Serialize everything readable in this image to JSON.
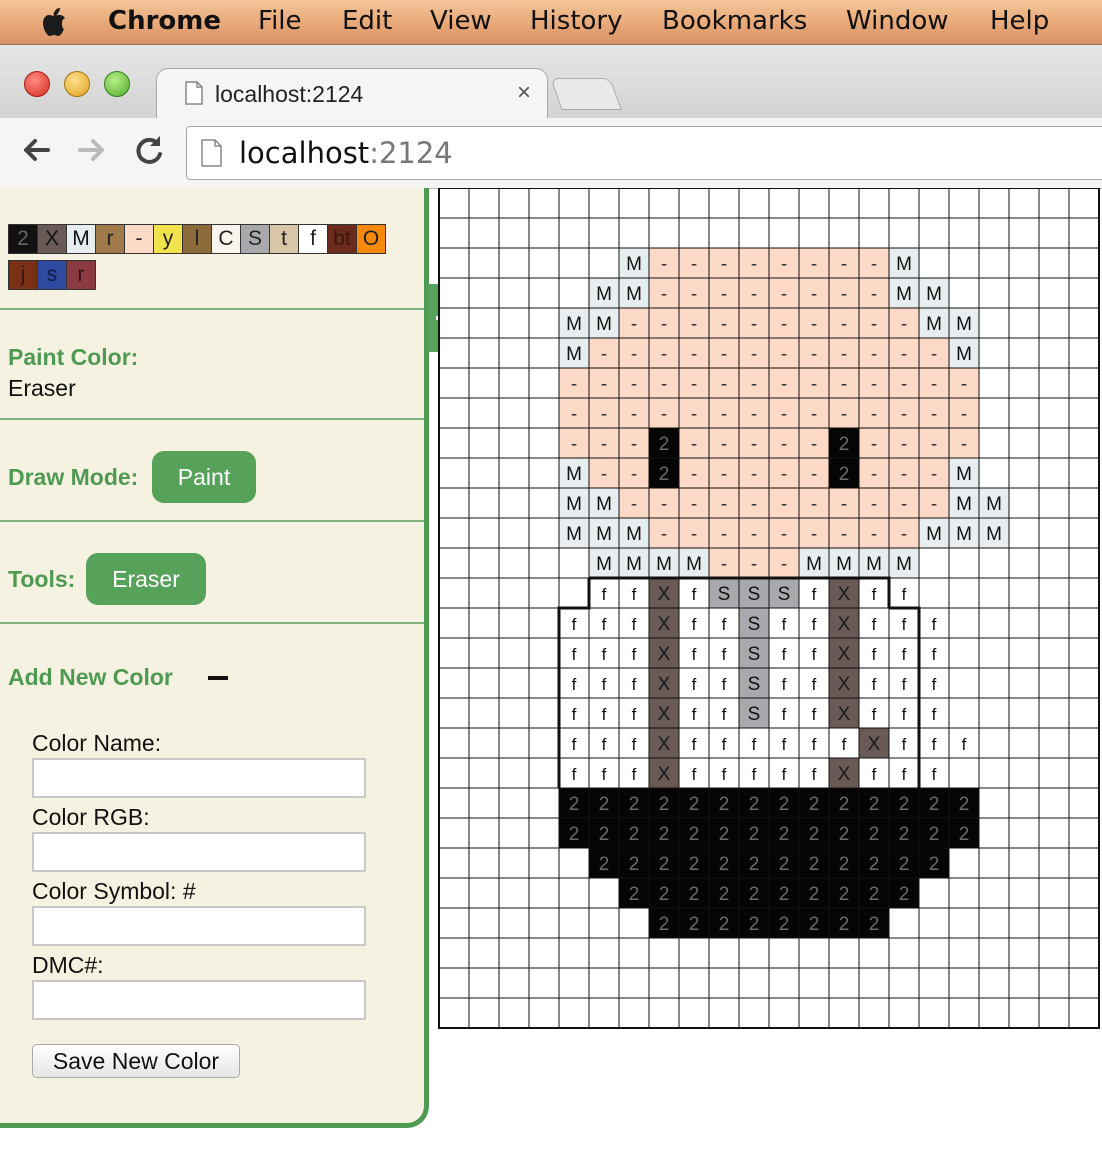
{
  "menubar": {
    "app_name": "Chrome",
    "items": [
      "File",
      "Edit",
      "View",
      "History",
      "Bookmarks",
      "Window",
      "Help"
    ]
  },
  "browser": {
    "tab_title": "localhost:2124",
    "tab_close": "×",
    "url_host": "localhost",
    "url_port": ":2124"
  },
  "palette": [
    {
      "symbol": "2",
      "color": "#111111",
      "text": "#666666"
    },
    {
      "symbol": "X",
      "color": "#6a5a57",
      "text": "#111111"
    },
    {
      "symbol": "M",
      "color": "#e8eef0",
      "text": "#111111"
    },
    {
      "symbol": "r",
      "color": "#a07a4b",
      "text": "#222222"
    },
    {
      "symbol": "-",
      "color": "#fdd9c7",
      "text": "#222222"
    },
    {
      "symbol": "y",
      "color": "#f2e24b",
      "text": "#222222"
    },
    {
      "symbol": "l",
      "color": "#8b6b3a",
      "text": "#222222"
    },
    {
      "symbol": "C",
      "color": "#f7f5ee",
      "text": "#222222"
    },
    {
      "symbol": "S",
      "color": "#a9a9ad",
      "text": "#222222"
    },
    {
      "symbol": "t",
      "color": "#d8c7a6",
      "text": "#222222"
    },
    {
      "symbol": "f",
      "color": "#ffffff",
      "text": "#222222"
    },
    {
      "symbol": "bt",
      "color": "#6a2a1c",
      "text": "#3a1510"
    },
    {
      "symbol": "O",
      "color": "#f78a0c",
      "text": "#222222"
    },
    {
      "symbol": "j",
      "color": "#7a3015",
      "text": "#3a1510"
    },
    {
      "symbol": "s",
      "color": "#2d4aa0",
      "text": "#111a44"
    },
    {
      "symbol": "r",
      "color": "#8a3a40",
      "text": "#3a1018"
    }
  ],
  "panel": {
    "paint_color_label": "Paint Color:",
    "paint_color_value": "Eraser",
    "draw_mode_label": "Draw Mode:",
    "draw_mode_button": "Paint",
    "tools_label": "Tools:",
    "tools_button": "Eraser",
    "add_color_label": "Add New Color",
    "add_color_toggle": "−",
    "color_name_label": "Color Name:",
    "color_rgb_label": "Color RGB:",
    "color_symbol_label": "Color Symbol: #",
    "dmc_label": "DMC#:",
    "save_button": "Save New Color",
    "inputs": {
      "color_name": "",
      "color_rgb": "",
      "color_symbol": "",
      "dmc": ""
    }
  },
  "colors": {
    "accent_green": "#56a25b",
    "panel_bg": "#f5f2e1"
  },
  "pattern": {
    "cols": 22,
    "rows": 28,
    "symbols": {
      "2": {
        "fill": "#050505",
        "text": "#6a6a6a"
      },
      "X": {
        "fill": "#6a5a57",
        "text": "#1a1a1a"
      },
      "M": {
        "fill": "#e8eef0",
        "text": "#111111"
      },
      "-": {
        "fill": "#fdd9c7",
        "text": "#333333"
      },
      "S": {
        "fill": "#a9a9ad",
        "text": "#111111"
      },
      "f": {
        "fill": "#ffffff",
        "text": "#111111"
      }
    },
    "cells": [
      "......................",
      "......................",
      "......M--------M......",
      ".....MM--------MM.....",
      "....MM----------MM....",
      "....M------------M....",
      "....--------------....",
      "....--------------....",
      "....---2-----2----....",
      "....M--2-----2---M....",
      "....MM-----------MM...",
      "....MMM---------MMM...",
      ".....MMMM---MMMM......",
      ".....ffXfSSSfXff......",
      "....fffXffSffXfff.....",
      "....fffXffSffXfff.....",
      "....fffXffSffXfff.....",
      "....fffXffSffXfff.....",
      "....fffXffffffXfff....",
      "....fffXfffffXfff.....",
      "....22222222222222....",
      "....22222222222222....",
      ".....222222222222.....",
      "......2222222222......",
      ".......22222222.......",
      "......................",
      "......................",
      "......................"
    ]
  }
}
